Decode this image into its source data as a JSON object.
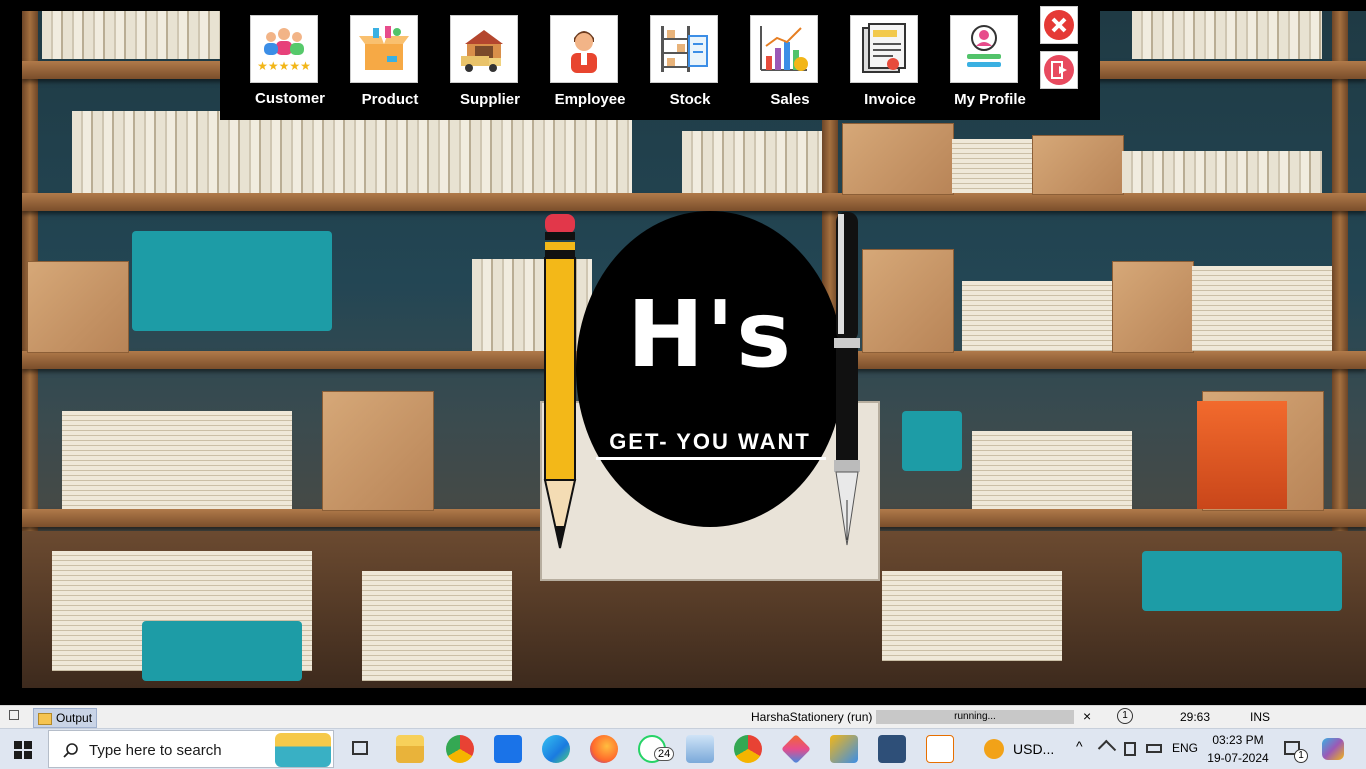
{
  "toolbar": {
    "items": [
      {
        "label": "Customer",
        "icon": "customers-icon"
      },
      {
        "label": "Product",
        "icon": "product-box-icon"
      },
      {
        "label": "Supplier",
        "icon": "supplier-truck-icon"
      },
      {
        "label": "Employee",
        "icon": "employee-icon"
      },
      {
        "label": "Stock",
        "icon": "stock-shelf-icon"
      },
      {
        "label": "Sales",
        "icon": "sales-chart-icon"
      },
      {
        "label": "Invoice",
        "icon": "invoice-icon"
      },
      {
        "label": "My Profile",
        "icon": "profile-icon"
      }
    ],
    "close_icon": "close-icon",
    "logout_icon": "logout-icon"
  },
  "logo": {
    "title": "H's",
    "tagline": "GET- YOU WANT"
  },
  "ide_status": {
    "output_tab": "Output",
    "project": "HarshaStationery (run)",
    "progress_text": "running...",
    "notifications": "1",
    "position": "29:63",
    "mode": "INS"
  },
  "taskbar": {
    "search_placeholder": "Type here to search",
    "whatsapp_badge": "24",
    "tray_label": "USD...",
    "language": "ENG",
    "time": "03:23 PM",
    "date": "19-07-2024",
    "notification_count": "1"
  },
  "colors": {
    "toolbar_bg": "#000000",
    "close_red": "#e53935",
    "taskbar_bg": "#dfe6f1"
  }
}
